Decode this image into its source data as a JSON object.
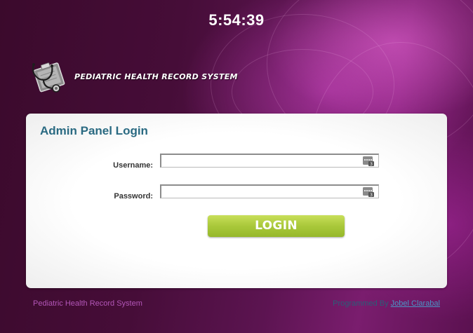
{
  "clock": "5:54:39",
  "header": {
    "system_title": "PEDIATRIC HEALTH RECORD SYSTEM",
    "logo_icon": "stethoscope-clipboard-icon"
  },
  "panel": {
    "title": "Admin Panel Login",
    "username": {
      "label": "Username:",
      "value": "",
      "icon": "password-manager-key-icon"
    },
    "password": {
      "label": "Password:",
      "value": "",
      "icon": "password-manager-key-icon"
    },
    "login_button": "LOGIN"
  },
  "footer": {
    "left_text": "Pediatric Health Record System",
    "programmed_by": "Programmed By",
    "author": "Jobel Clarabal"
  },
  "colors": {
    "background": "#4a0d3a",
    "panel_title": "#2a6a82",
    "button_green": "#a9c83a",
    "footer_left": "#b356b8",
    "footer_link": "#4a94c6"
  }
}
